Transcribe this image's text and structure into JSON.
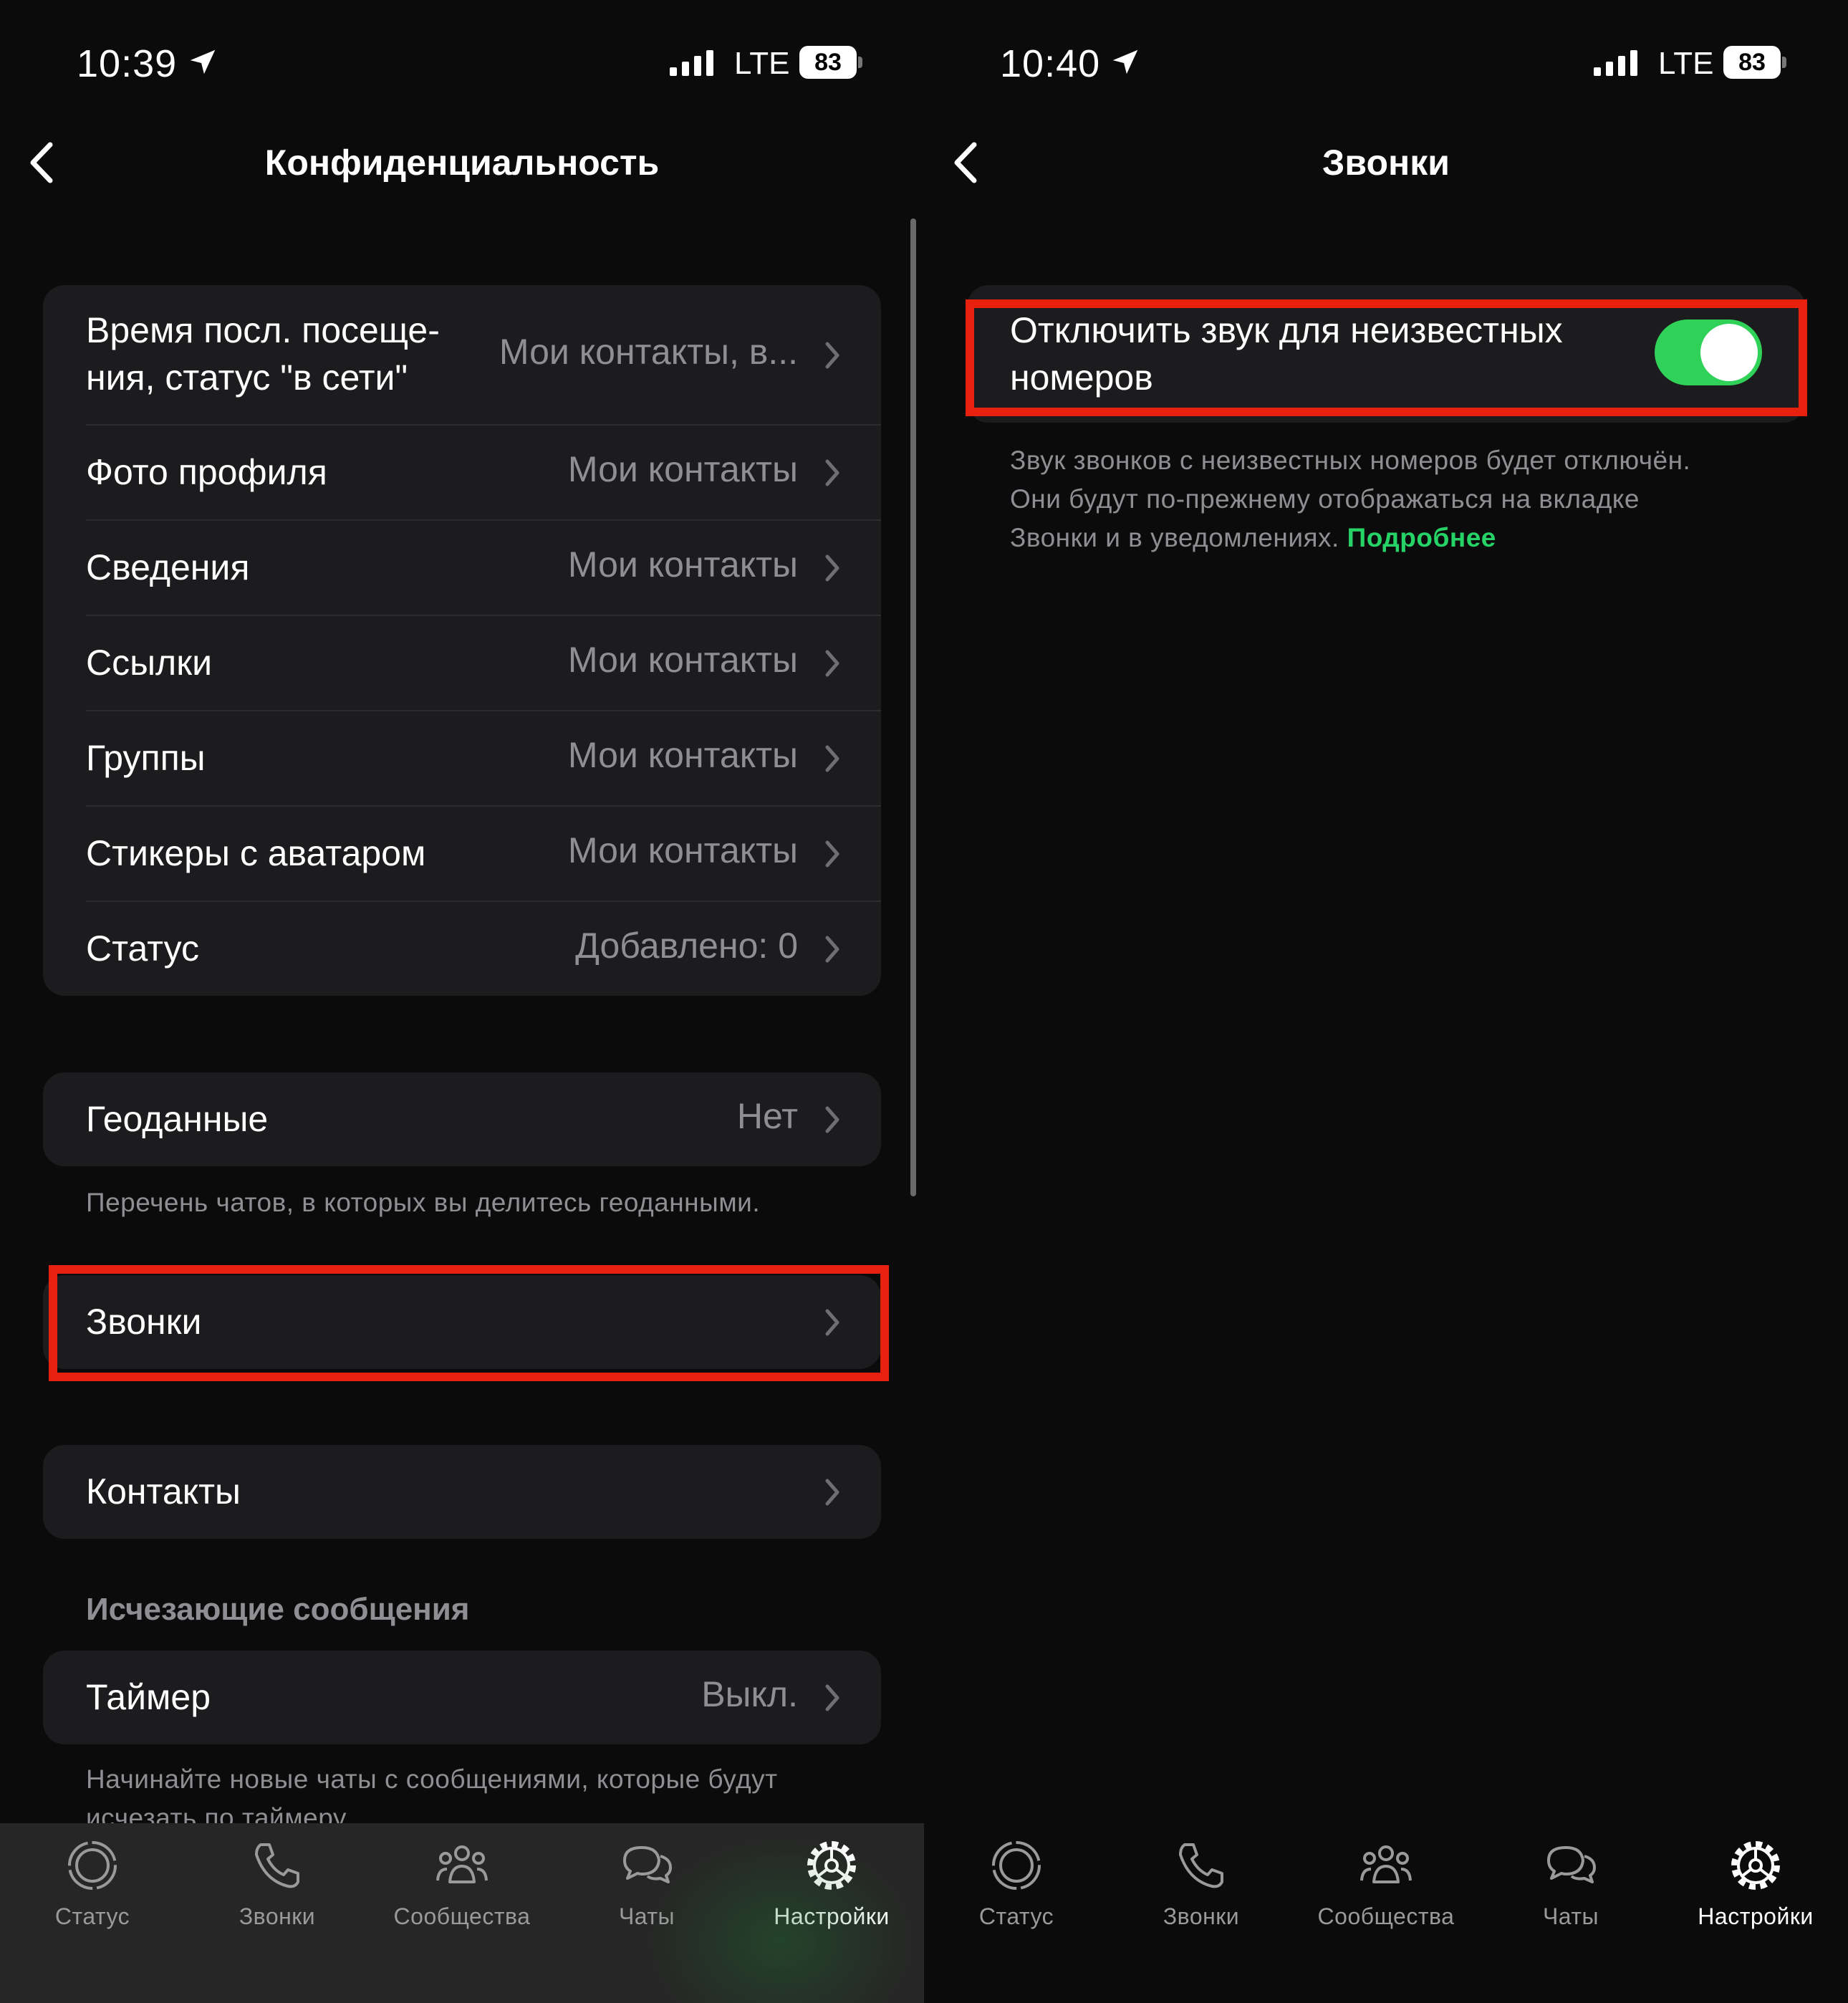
{
  "left": {
    "status_bar": {
      "time": "10:39",
      "network": "LTE",
      "battery": "83"
    },
    "nav": {
      "title": "Конфиденциальность"
    },
    "privacy_rows": [
      {
        "label_line1": "Время посл. посеще-",
        "label_line2": "ния, статус \"в сети\"",
        "value": "Мои контакты, в..."
      },
      {
        "label": "Фото профиля",
        "value": "Мои контакты"
      },
      {
        "label": "Сведения",
        "value": "Мои контакты"
      },
      {
        "label": "Ссылки",
        "value": "Мои контакты"
      },
      {
        "label": "Группы",
        "value": "Мои контакты"
      },
      {
        "label": "Стикеры с аватаром",
        "value": "Мои контакты"
      },
      {
        "label": "Статус",
        "value": "Добавлено: 0"
      }
    ],
    "geo": {
      "label": "Геоданные",
      "value": "Нет",
      "footnote": "Перечень чатов, в которых вы делитесь геоданными."
    },
    "calls": {
      "label": "Звонки"
    },
    "contacts": {
      "label": "Контакты"
    },
    "disappearing": {
      "header": "Исчезающие сообщения",
      "timer_label": "Таймер",
      "timer_value": "Выкл.",
      "footnote_line1": "Начинайте новые чаты с сообщениями, которые будут",
      "footnote_line2": "исчезать по таймеру."
    }
  },
  "right": {
    "status_bar": {
      "time": "10:40",
      "network": "LTE",
      "battery": "83"
    },
    "nav": {
      "title": "Звонки"
    },
    "silence": {
      "label_line1": "Отключить звук для неизвестных",
      "label_line2": "номеров",
      "enabled": true,
      "footnote_line1": "Звук звонков с неизвестных номеров будет отключён.",
      "footnote_line2": "Они будут по-прежнему отображаться на вкладке",
      "footnote_line3": "Звонки и в уведомлениях.",
      "link": "Подробнее"
    }
  },
  "tabbar": {
    "tabs": [
      {
        "label": "Статус",
        "icon": "status-icon"
      },
      {
        "label": "Звонки",
        "icon": "phone-icon"
      },
      {
        "label": "Сообщества",
        "icon": "communities-icon"
      },
      {
        "label": "Чаты",
        "icon": "chats-icon"
      },
      {
        "label": "Настройки",
        "icon": "settings-icon",
        "active": true
      }
    ]
  },
  "colors": {
    "accent": "#25d366",
    "toggle_on": "#30d158",
    "highlight": "#e8210f",
    "background": "#0b0b0b",
    "cell": "#1c1c1e"
  }
}
